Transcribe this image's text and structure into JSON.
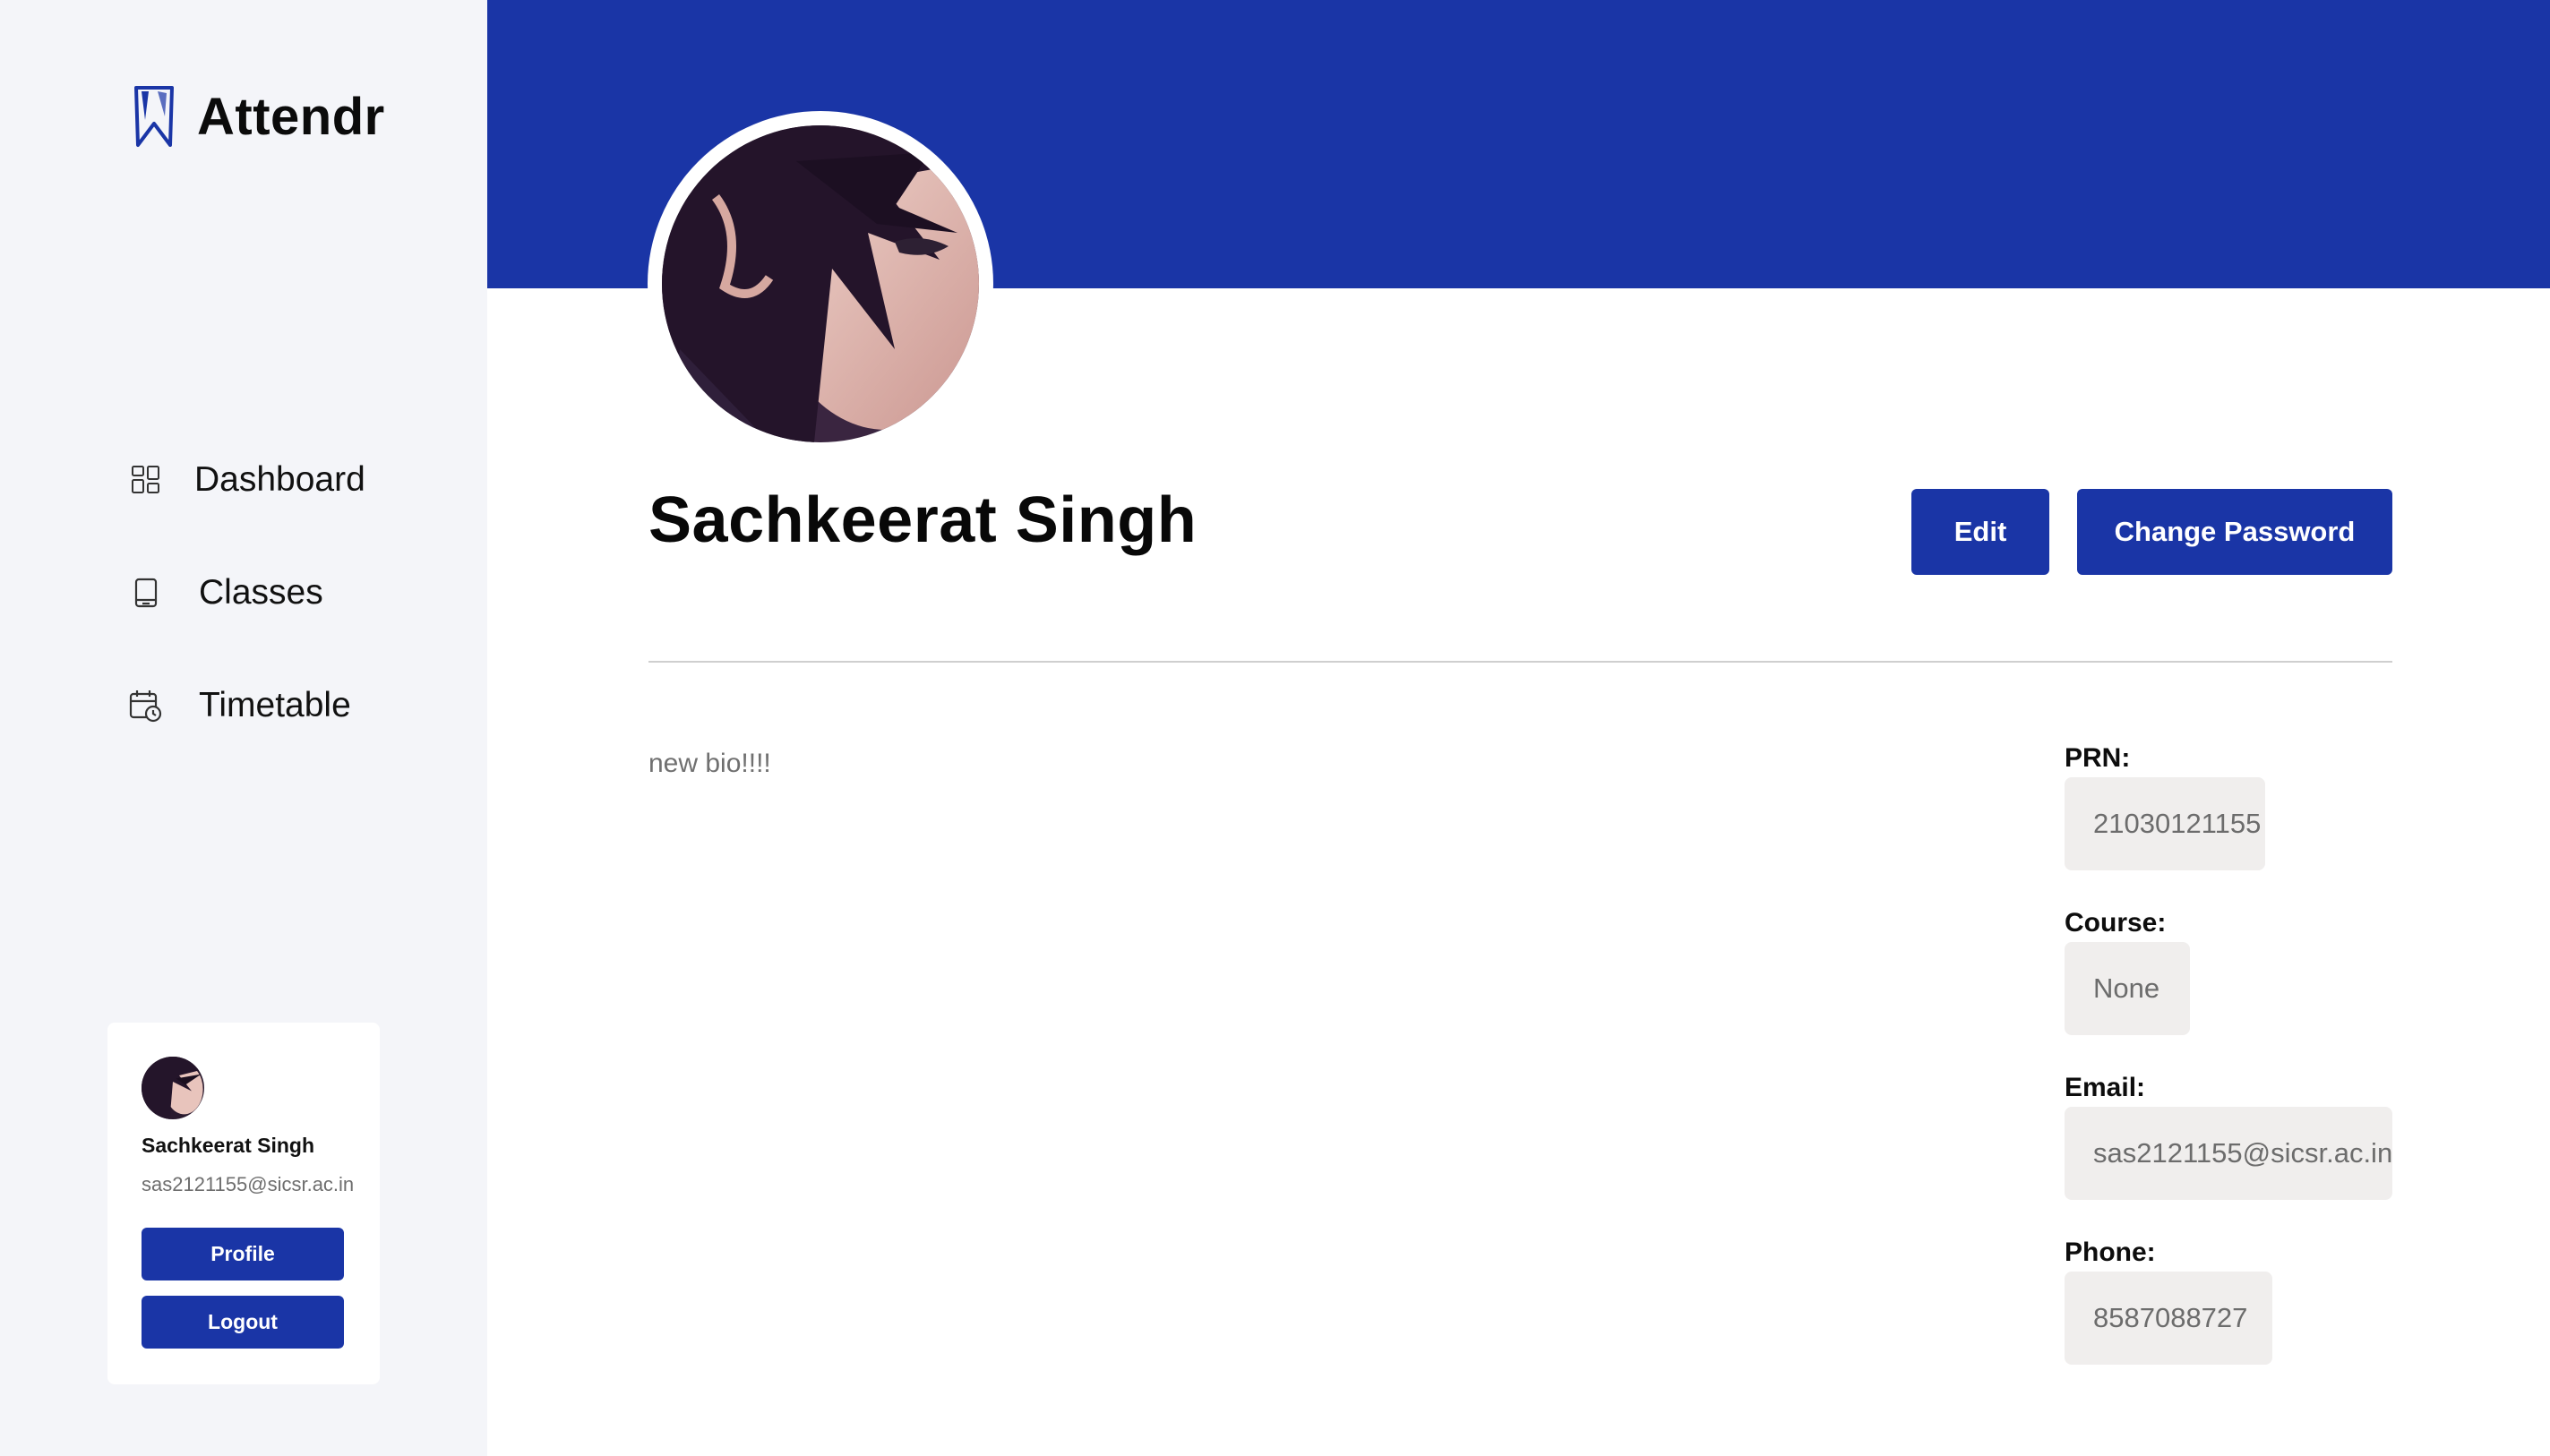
{
  "app": {
    "name": "Attendr",
    "accent_color": "#1a35a6"
  },
  "sidebar": {
    "items": [
      {
        "label": "Dashboard",
        "icon": "dashboard-grid-icon"
      },
      {
        "label": "Classes",
        "icon": "book-icon"
      },
      {
        "label": "Timetable",
        "icon": "calendar-clock-icon"
      }
    ]
  },
  "user_card": {
    "name": "Sachkeerat Singh",
    "email": "sas2121155@sicsr.ac.in",
    "profile_label": "Profile",
    "logout_label": "Logout"
  },
  "profile": {
    "name": "Sachkeerat Singh",
    "edit_label": "Edit",
    "change_password_label": "Change Password",
    "bio": "new bio!!!!",
    "fields": {
      "prn": {
        "label": "PRN:",
        "value": "21030121155"
      },
      "course": {
        "label": "Course:",
        "value": "None"
      },
      "email": {
        "label": "Email:",
        "value": "sas2121155@sicsr.ac.in"
      },
      "phone": {
        "label": "Phone:",
        "value": "8587088727"
      }
    }
  }
}
